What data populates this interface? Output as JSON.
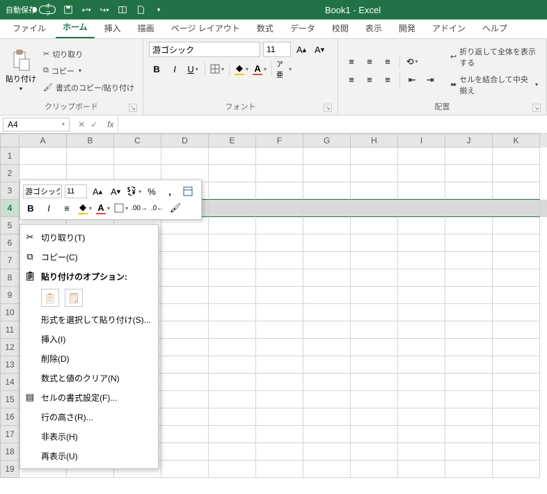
{
  "titlebar": {
    "autosave_label": "自動保存",
    "autosave_state": "オフ",
    "document_title": "Book1 - Excel"
  },
  "tabs": [
    "ファイル",
    "ホーム",
    "挿入",
    "描画",
    "ページ レイアウト",
    "数式",
    "データ",
    "校閲",
    "表示",
    "開発",
    "アドイン",
    "ヘルプ"
  ],
  "active_tab": "ホーム",
  "clipboard": {
    "paste": "貼り付け",
    "cut": "切り取り",
    "copy": "コピー",
    "format_painter": "書式のコピー/貼り付け",
    "group_label": "クリップボード"
  },
  "font": {
    "name": "游ゴシック",
    "size": "11",
    "group_label": "フォント"
  },
  "alignment": {
    "wrap": "折り返して全体を表示する",
    "merge": "セルを結合して中央揃え",
    "group_label": "配置"
  },
  "name_box": "A4",
  "columns": [
    "A",
    "B",
    "C",
    "D",
    "E",
    "F",
    "G",
    "H",
    "I",
    "J",
    "K"
  ],
  "row_count": 19,
  "selected_row": 4,
  "mini_toolbar": {
    "font": "游ゴシック",
    "size": "11"
  },
  "context_menu": {
    "cut": "切り取り(T)",
    "copy": "コピー(C)",
    "paste_options_header": "貼り付けのオプション:",
    "paste_special": "形式を選択して貼り付け(S)...",
    "insert": "挿入(I)",
    "delete": "削除(D)",
    "clear": "数式と値のクリア(N)",
    "format_cells": "セルの書式設定(F)...",
    "row_height": "行の高さ(R)...",
    "hide": "非表示(H)",
    "unhide": "再表示(U)"
  },
  "chart_data": null
}
